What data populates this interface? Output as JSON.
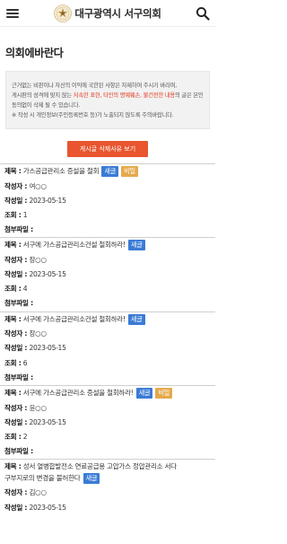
{
  "header": {
    "title": "대구광역시 서구의회",
    "menu_icon": "hamburger-icon",
    "search_icon": "search-icon"
  },
  "page_title": "의회에바란다",
  "notice": {
    "line1": "근거없는 비판이나 자신의 이익에 국한된 사항은 자제하여 주시기 바라며,",
    "line2_a": "게시판의 성격에 맞지 않는 ",
    "line2_red": "저속한 표현, 타인의 명예훼손, 불건전한 내용",
    "line2_b": "의 글은 본인 동의없이 삭제 될 수 있습니다.",
    "line3": "※ 작성 시 개인정보(주민등록번호 등)가 노출되지 않도록 주의바랍니다."
  },
  "reason_button": "게시글 삭제사유 보기",
  "labels": {
    "subject": "제목 : ",
    "author": "작성자 : ",
    "date": "작성일 : ",
    "views": "조회 : ",
    "attach": "첨부파일 : ",
    "new_badge": "새글",
    "secret_badge": "비밀"
  },
  "posts": [
    {
      "title": "가스공급관리소 증설을 철회",
      "author": "여○○",
      "date": "2023-05-15",
      "views": "1",
      "attach": ""
    },
    {
      "title": "서구에 가스공급관리소건설 철회하라!",
      "author": "장○○",
      "date": "2023-05-15",
      "views": "4",
      "attach": ""
    },
    {
      "title": "서구에 가스공급관리소건설 철회하라!",
      "author": "장○○",
      "date": "2023-05-15",
      "views": "6",
      "attach": ""
    },
    {
      "title": "서구에 가스공급관리소 증설을 철회하라!",
      "author": "윤○○",
      "date": "2023-05-15",
      "views": "2",
      "attach": ""
    },
    {
      "title_a": "성서 열병합발전소 연료공급용 고압가스 정압관리소 서다",
      "title_b": "구부지로의 변경을 불허한다",
      "author": "김○○",
      "date": "2023-05-15"
    }
  ],
  "colors": {
    "accent": "#e8552f",
    "new": "#3a7bd5",
    "secret": "#e5a94b",
    "warning_text": "#e03a1e"
  }
}
